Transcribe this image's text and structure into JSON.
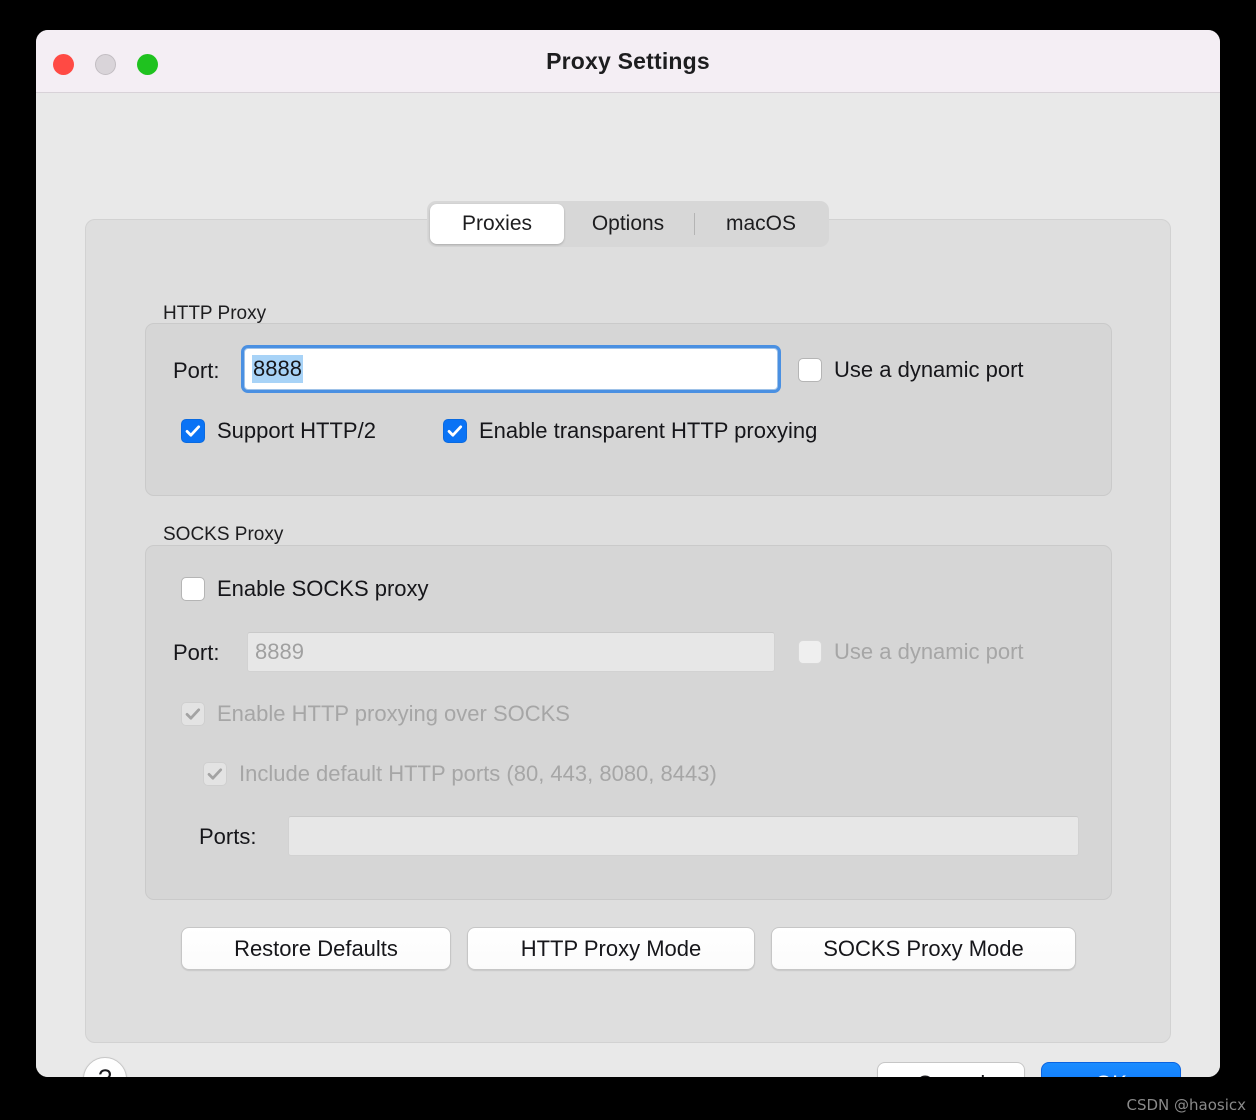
{
  "window": {
    "title": "Proxy Settings",
    "traffic_lights": [
      {
        "name": "close",
        "color": "#ff4a44"
      },
      {
        "name": "minimize",
        "color": "#d9d4d9"
      },
      {
        "name": "zoom",
        "color": "#1fc21f"
      }
    ]
  },
  "tabs": [
    {
      "label": "Proxies",
      "active": true
    },
    {
      "label": "Options",
      "active": false
    },
    {
      "label": "macOS",
      "active": false
    }
  ],
  "http_proxy": {
    "group_label": "HTTP Proxy",
    "port_label": "Port:",
    "port_value": "8888",
    "port_selected": true,
    "dynamic_port_label": "Use a dynamic port",
    "dynamic_port_checked": false,
    "support_http2_label": "Support HTTP/2",
    "support_http2_checked": true,
    "transparent_label": "Enable transparent HTTP proxying",
    "transparent_checked": true
  },
  "socks_proxy": {
    "group_label": "SOCKS Proxy",
    "enable_label": "Enable SOCKS proxy",
    "enable_checked": false,
    "port_label": "Port:",
    "port_value": "8889",
    "port_disabled": true,
    "dynamic_port_label": "Use a dynamic port",
    "dynamic_port_checked": false,
    "dynamic_port_disabled": true,
    "http_over_socks_label": "Enable HTTP proxying over SOCKS",
    "http_over_socks_checked": true,
    "http_over_socks_disabled": true,
    "default_ports_label": "Include default HTTP ports (80, 443, 8080, 8443)",
    "default_ports_checked": true,
    "default_ports_disabled": true,
    "ports_label": "Ports:",
    "ports_value": "",
    "ports_disabled": true
  },
  "mode_buttons": {
    "restore_defaults": "Restore Defaults",
    "http_proxy_mode": "HTTP Proxy Mode",
    "socks_proxy_mode": "SOCKS Proxy Mode"
  },
  "footer": {
    "help": "?",
    "cancel": "Cancel",
    "ok": "OK"
  },
  "watermark": "CSDN @haosicx",
  "colors": {
    "accent": "#0a73f5",
    "focus_ring": "#4a90e2",
    "selection": "#a8d3f7",
    "titlebar": "#f4eef4"
  }
}
